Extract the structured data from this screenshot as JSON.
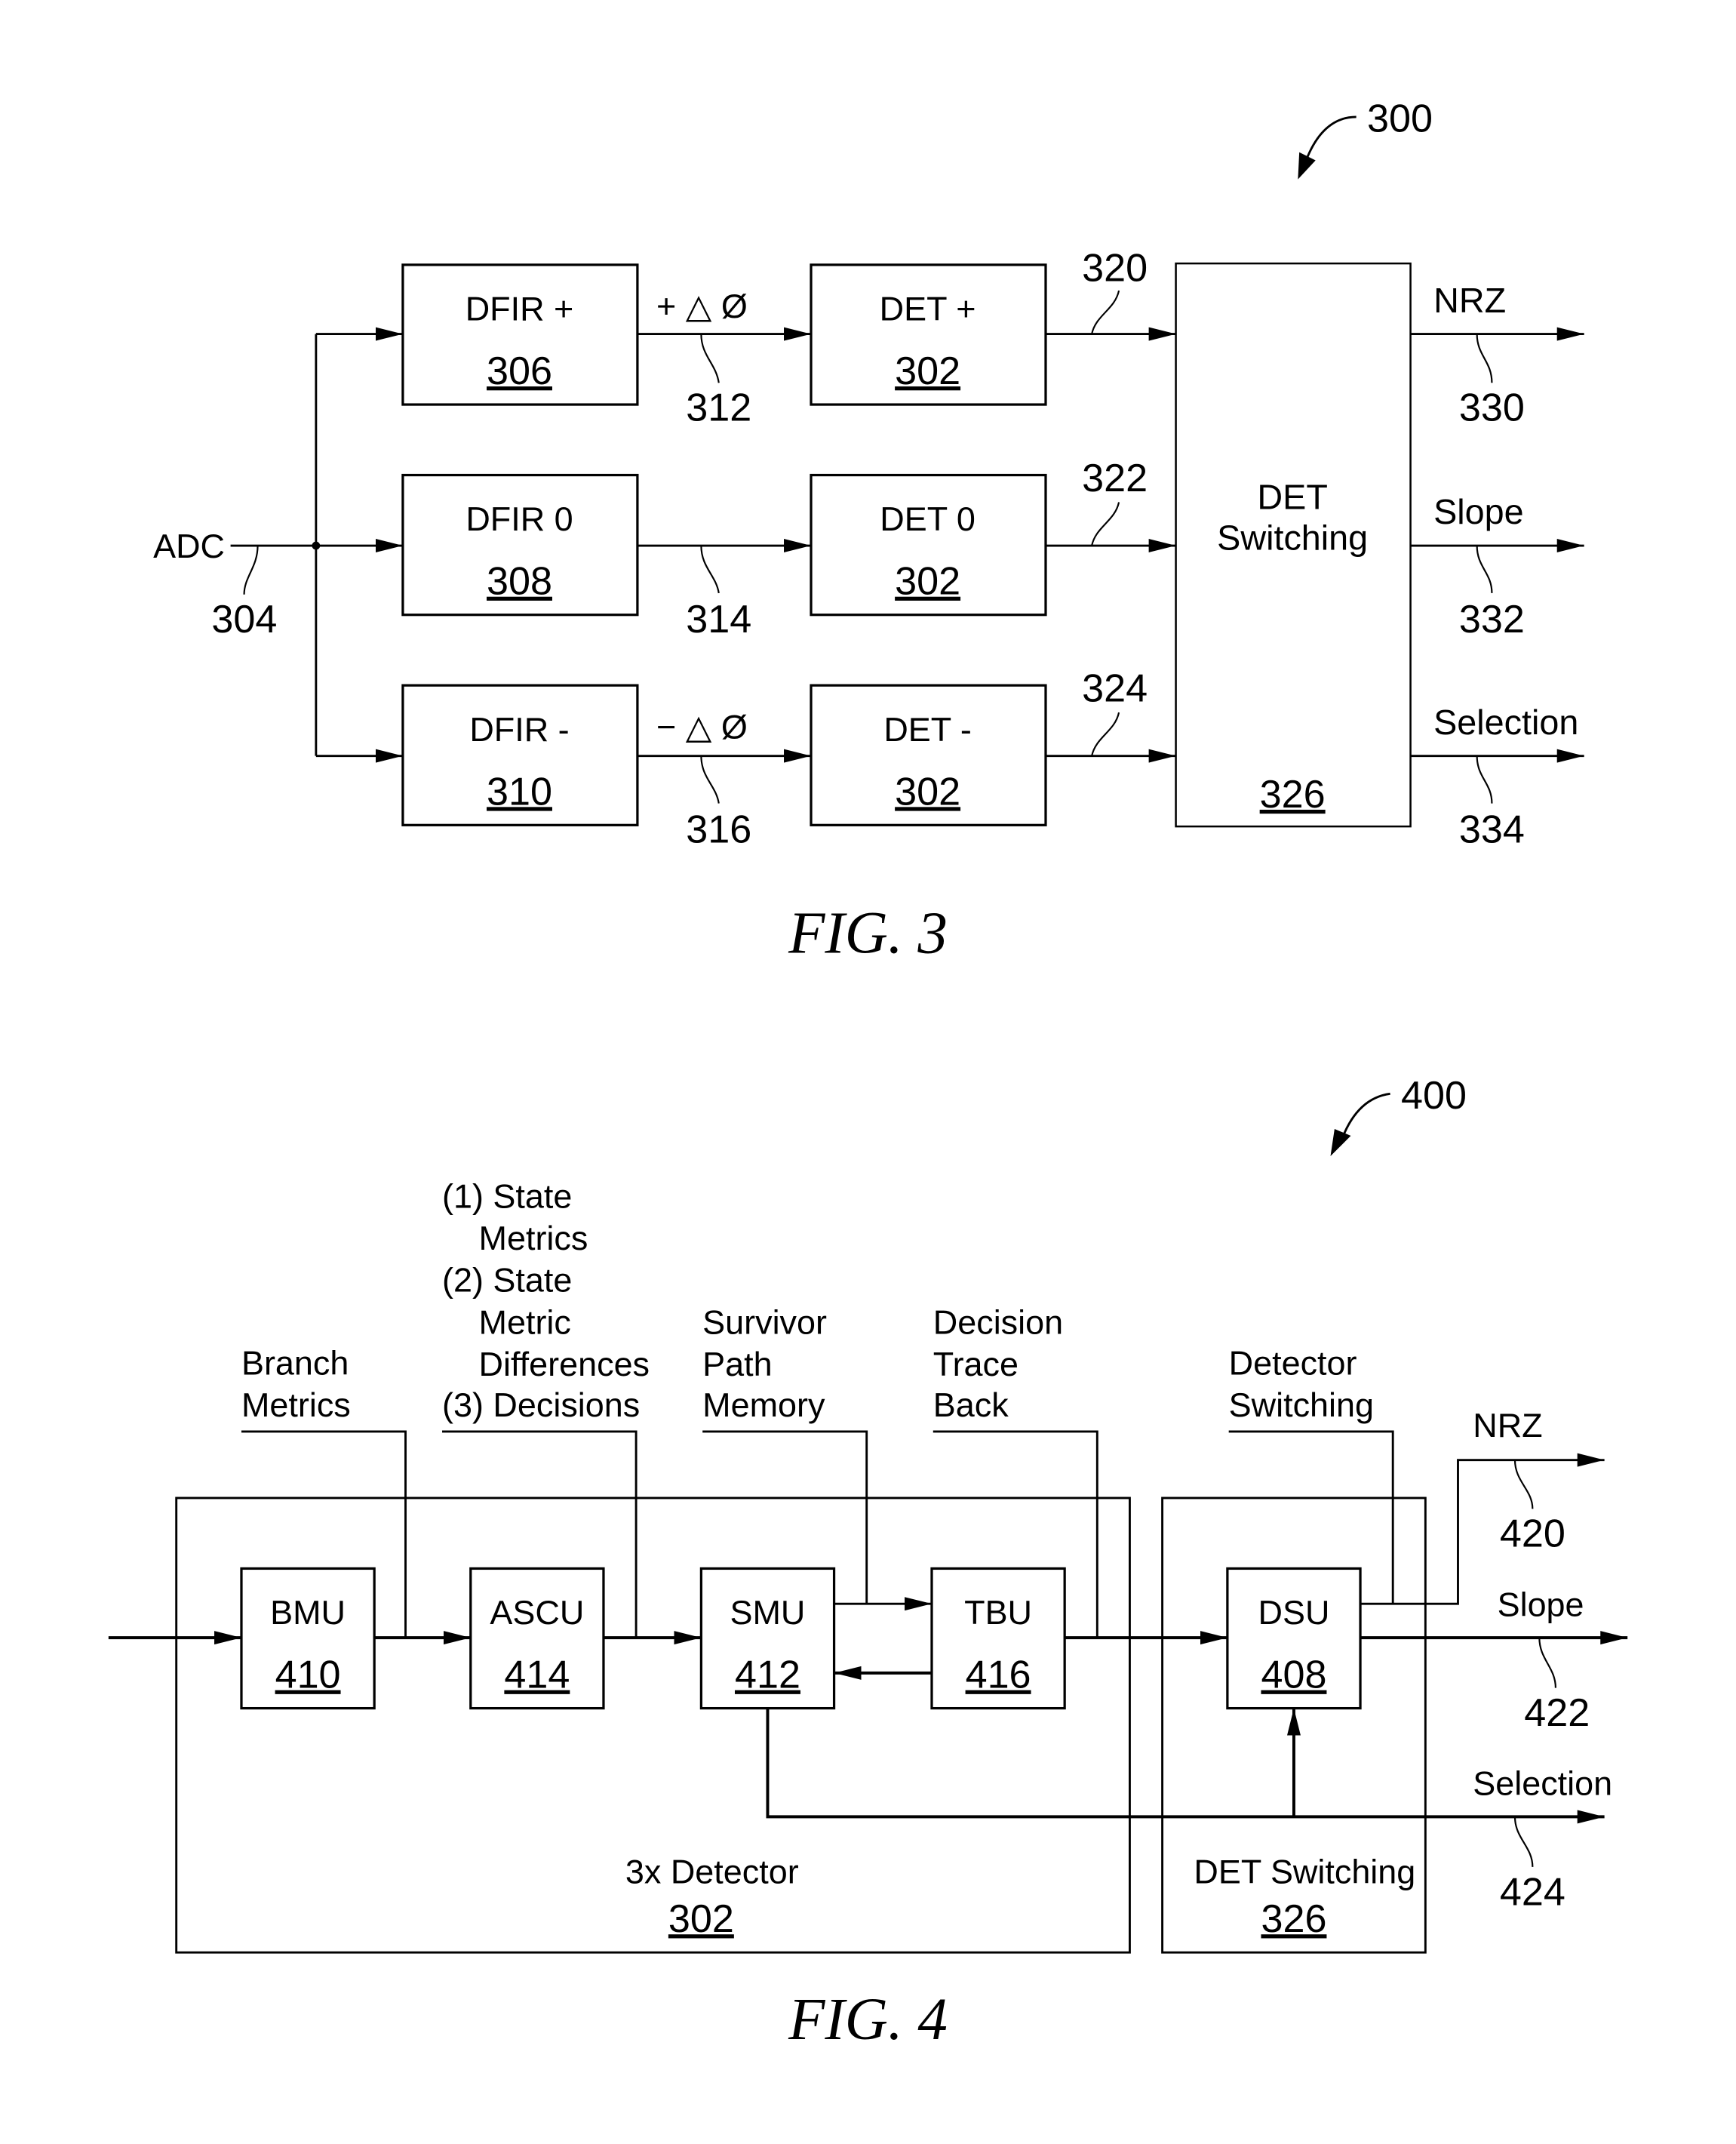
{
  "fig3": {
    "ref": "300",
    "caption": "FIG. 3",
    "input": {
      "label": "ADC",
      "ref": "304"
    },
    "dfir": [
      {
        "name": "DFIR +",
        "ref": "306",
        "out_label": "+ △ Ø",
        "out_ref": "312"
      },
      {
        "name": "DFIR 0",
        "ref": "308",
        "out_label": "",
        "out_ref": "314"
      },
      {
        "name": "DFIR -",
        "ref": "310",
        "out_label": "− △ Ø",
        "out_ref": "316"
      }
    ],
    "det": [
      {
        "name": "DET +",
        "ref": "302",
        "out_ref": "320"
      },
      {
        "name": "DET 0",
        "ref": "302",
        "out_ref": "322"
      },
      {
        "name": "DET -",
        "ref": "302",
        "out_ref": "324"
      }
    ],
    "switching": {
      "line1": "DET",
      "line2": "Switching",
      "ref": "326"
    },
    "outputs": [
      {
        "label": "NRZ",
        "ref": "330"
      },
      {
        "label": "Slope",
        "ref": "332"
      },
      {
        "label": "Selection",
        "ref": "334"
      }
    ]
  },
  "fig4": {
    "ref": "400",
    "caption": "FIG. 4",
    "blocks": {
      "bmu": {
        "name": "BMU",
        "ref": "410"
      },
      "ascu": {
        "name": "ASCU",
        "ref": "414"
      },
      "smu": {
        "name": "SMU",
        "ref": "412"
      },
      "tbu": {
        "name": "TBU",
        "ref": "416"
      },
      "dsu": {
        "name": "DSU",
        "ref": "408"
      }
    },
    "callouts": {
      "branch": [
        "Branch",
        "Metrics"
      ],
      "ascu": [
        "(1) State",
        "Metrics",
        "(2) State",
        "Metric",
        "Differences",
        "(3) Decisions"
      ],
      "survivor": [
        "Survivor",
        "Path",
        "Memory"
      ],
      "traceback": [
        "Decision",
        "Trace",
        "Back"
      ],
      "detector_switching": [
        "Detector",
        "Switching"
      ]
    },
    "detector_group": {
      "label": "3x Detector",
      "ref": "302"
    },
    "switching_group": {
      "label": "DET Switching",
      "ref": "326"
    },
    "outputs": [
      {
        "label": "NRZ",
        "ref": "420"
      },
      {
        "label": "Slope",
        "ref": "422"
      },
      {
        "label": "Selection",
        "ref": "424"
      }
    ]
  }
}
